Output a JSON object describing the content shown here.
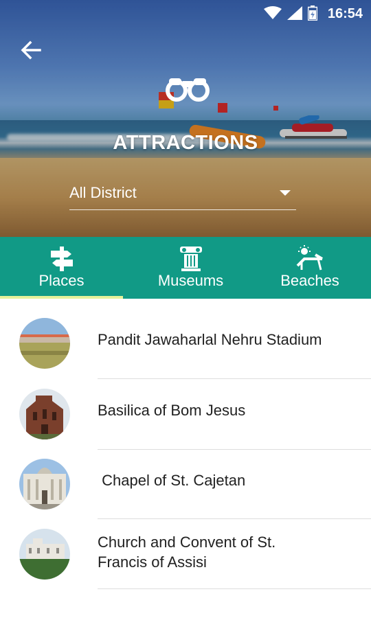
{
  "status_bar": {
    "time": "16:54",
    "icons": [
      "wifi-icon",
      "signal-icon",
      "battery-icon"
    ]
  },
  "header": {
    "back_icon": "arrow-left-icon",
    "icon": "binoculars-icon",
    "title": "ATTRACTIONS",
    "district_select": {
      "selected": "All District"
    }
  },
  "tabs": [
    {
      "label": "Places",
      "icon": "signpost-icon",
      "active": true
    },
    {
      "label": "Museums",
      "icon": "museum-icon",
      "active": false
    },
    {
      "label": "Beaches",
      "icon": "beach-chair-icon",
      "active": false
    }
  ],
  "places": [
    {
      "name": "Pandit Jawaharlal Nehru Stadium"
    },
    {
      "name": "Basilica of Bom Jesus"
    },
    {
      "name": " Chapel of St. Cajetan"
    },
    {
      "name": "Church and Convent of St.",
      "name_line2": "Francis of Assisi"
    }
  ],
  "colors": {
    "tab_bar": "#119a86",
    "tab_indicator": "#e5f29a",
    "text_primary": "#212121",
    "divider": "#dddddd"
  }
}
